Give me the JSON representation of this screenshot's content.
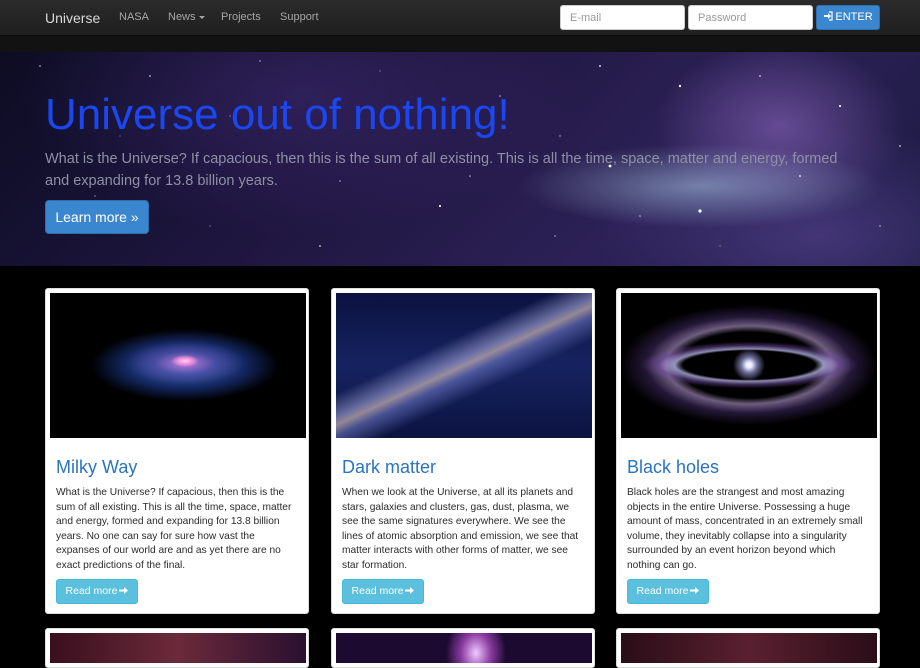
{
  "navbar": {
    "brand": "Universe",
    "links": [
      {
        "label": "NASA"
      },
      {
        "label": "News"
      },
      {
        "label": "Projects"
      },
      {
        "label": "Support"
      }
    ],
    "email_placeholder": "E-mail",
    "password_placeholder": "Password",
    "enter_label": "ENTER",
    "enter_icon": "sign-in-icon"
  },
  "hero": {
    "title": "Universe out of nothing!",
    "text": "What is the Universe? If capacious, then this is the sum of all existing. This is all the time, space, matter and energy, formed and expanding for 13.8 billion years.",
    "button_label": "Learn more »"
  },
  "cards": [
    {
      "title": "Milky Way",
      "text": "What is the Universe? If capacious, then this is the sum of all existing. This is all the time, space, matter and energy, formed and expanding for 13.8 billion years. No one can say for sure how vast the expanses of our world are and as yet there are no exact predictions of the final.",
      "button_label": "Read more",
      "button_icon": "arrow-right-icon"
    },
    {
      "title": "Dark matter",
      "text": "When we look at the Universe, at all its planets and stars, galaxies and clusters, gas, dust, plasma, we see the same signatures everywhere. We see the lines of atomic absorption and emission, we see that matter interacts with other forms of matter, we see star formation.",
      "button_label": "Read more",
      "button_icon": "arrow-right-icon"
    },
    {
      "title": "Black holes",
      "text": "Black holes are the strangest and most amazing objects in the entire Universe. Possessing a huge amount of mass, concentrated in an extremely small volume, they inevitably collapse into a singularity surrounded by an event horizon beyond which nothing can go.",
      "button_label": "Read more",
      "button_icon": "arrow-right-icon"
    }
  ],
  "colors": {
    "hero_title": "#1a47f0",
    "primary_button": "#3a86cf",
    "info_button": "#5bc0de",
    "card_title": "#2a74c2"
  }
}
